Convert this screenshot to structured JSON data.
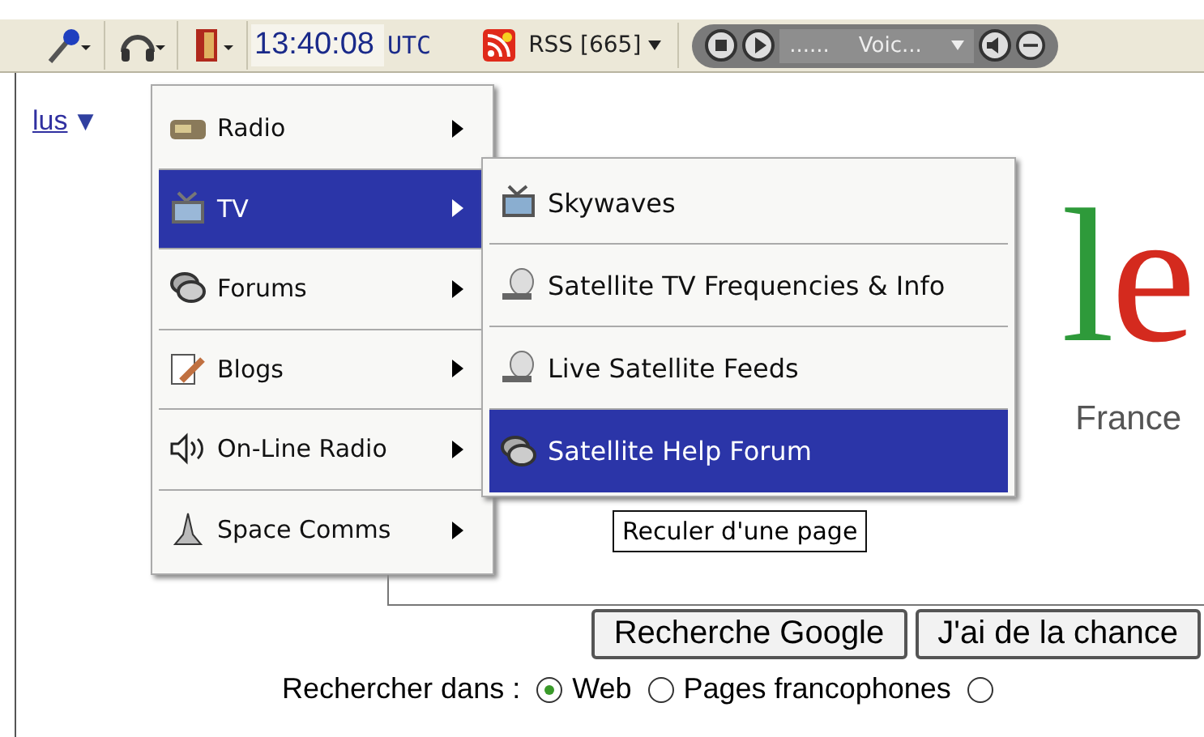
{
  "toolbar": {
    "time": "13:40:08",
    "zone": "UTC",
    "rss": "RSS [665]",
    "player": {
      "dots": "......",
      "station": "Voic..."
    }
  },
  "page": {
    "link": "lus",
    "link_caret": "▼",
    "logo": "le",
    "logo_sub": "France",
    "buttons": [
      "Recherche Google",
      "J'ai de la chance"
    ],
    "search_label": "Rechercher dans :",
    "scopes": [
      {
        "label": "Web",
        "selected": true
      },
      {
        "label": "Pages francophones",
        "selected": false
      },
      {
        "selected": false
      }
    ]
  },
  "menu": {
    "items": [
      {
        "label": "Radio",
        "kind": "radio",
        "selected": false
      },
      {
        "label": "TV",
        "kind": "tv",
        "selected": true
      },
      {
        "label": "Forums",
        "kind": "chat",
        "selected": false
      },
      {
        "label": "Blogs",
        "kind": "blog",
        "selected": false
      },
      {
        "label": "On-Line Radio",
        "kind": "speaker",
        "selected": false
      },
      {
        "label": "Space Comms",
        "kind": "rocket",
        "selected": false
      }
    ]
  },
  "submenu": {
    "items": [
      {
        "label": "Skywaves",
        "kind": "tv",
        "selected": false
      },
      {
        "label": "Satellite TV Frequencies & Info",
        "kind": "dish",
        "selected": false
      },
      {
        "label": "Live Satellite Feeds",
        "kind": "dish",
        "selected": false
      },
      {
        "label": "Satellite Help Forum",
        "kind": "chat",
        "selected": true
      }
    ]
  },
  "tooltip": "Reculer d'une page"
}
